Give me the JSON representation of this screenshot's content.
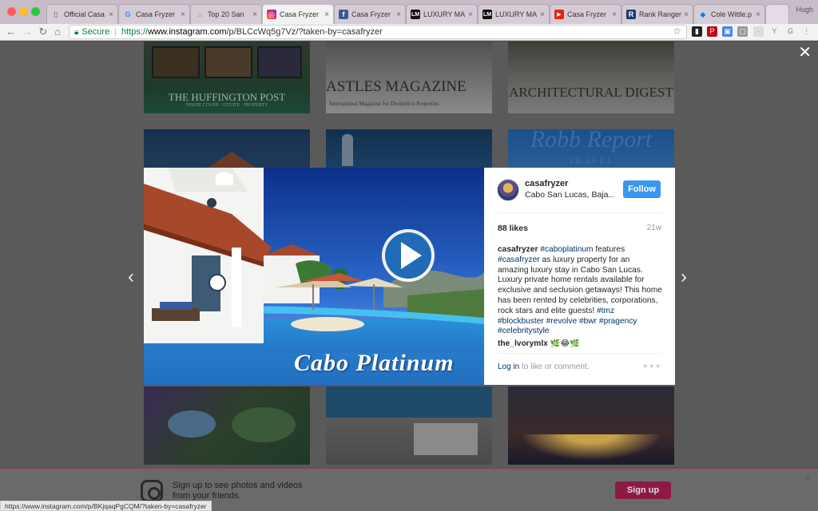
{
  "browser": {
    "tabs": [
      {
        "label": "Official Casa",
        "favicon": "doc-icon"
      },
      {
        "label": "Casa Fryzer",
        "favicon": "google-icon"
      },
      {
        "label": "Top 20 San",
        "favicon": "airbnb-icon"
      },
      {
        "label": "Casa Fryzer",
        "favicon": "instagram-icon",
        "active": true
      },
      {
        "label": "Casa Fryzer",
        "favicon": "facebook-icon"
      },
      {
        "label": "LUXURY MA",
        "favicon": "lm-icon"
      },
      {
        "label": "LUXURY MA",
        "favicon": "lm-icon"
      },
      {
        "label": "Casa Fryzer",
        "favicon": "youtube-icon"
      },
      {
        "label": "Rank Ranger",
        "favicon": "r-icon"
      },
      {
        "label": "Cole Wittle.p",
        "favicon": "dropbox-icon"
      }
    ],
    "tab_close": "×",
    "user": "Hugh",
    "secure_label": "Secure",
    "url_scheme": "https://",
    "url_host": "www.instagram.com",
    "url_path": "/p/BLCcWq5g7Vz/?taken-by=casafryzer",
    "status_url": "https://www.instagram.com/p/BKjqaqPgCQM/?taken-by=casafryzer"
  },
  "grid": {
    "captions": [
      "THE HUFFINGTON POST",
      "ASTLES MAGAZINE",
      "ARCHITECTURAL DIGEST",
      "Robb Report"
    ],
    "huffpo_sub": "INSIDE COVER · ESTATE · PROPERTY",
    "castles_sub": "International Magazine for Distinctive Properties",
    "robb_sub": "TRAVEL"
  },
  "modal": {
    "close_label": "✕",
    "prev_label": "‹",
    "next_label": "›",
    "overlay_text": "Cabo Platinum",
    "username": "casafryzer",
    "location": "Cabo San Lucas, Baja...",
    "follow_label": "Follow",
    "likes": "88 likes",
    "time_ago": "21w",
    "caption": {
      "user": "casafryzer",
      "parts": [
        {
          "text": " "
        },
        {
          "text": "#caboplatinum",
          "tag": true
        },
        {
          "text": " features "
        },
        {
          "text": "#casafryzer",
          "tag": true
        },
        {
          "text": " as luxury property for an amazing luxury stay in Cabo San Lucas. Luxury private home rentals available for exclusive and seclusion getaways! This home has been rented by celebrities, corporations, rock stars and elite guests! "
        },
        {
          "text": "#tmz",
          "tag": true
        },
        {
          "text": " "
        },
        {
          "text": "#blockbuster",
          "tag": true
        },
        {
          "text": " "
        },
        {
          "text": "#revolve",
          "tag": true
        },
        {
          "text": " "
        },
        {
          "text": "#bwr",
          "tag": true
        },
        {
          "text": " "
        },
        {
          "text": "#pragency",
          "tag": true
        },
        {
          "text": " "
        },
        {
          "text": "#celebritystyle",
          "tag": true
        }
      ]
    },
    "comment_user": "the_lvorymlx",
    "comment_text": "🌿😂🌿",
    "login_link": "Log in",
    "login_rest": " to like or comment.",
    "more_label": "∘∘∘"
  },
  "signup_bar": {
    "text": "Sign up to see photos and videos from your friends.",
    "button": "Sign up",
    "close": "×"
  },
  "colors": {
    "follow_blue": "#3897f0",
    "hashtag": "#003569",
    "signup_button": "#8d1a45"
  }
}
